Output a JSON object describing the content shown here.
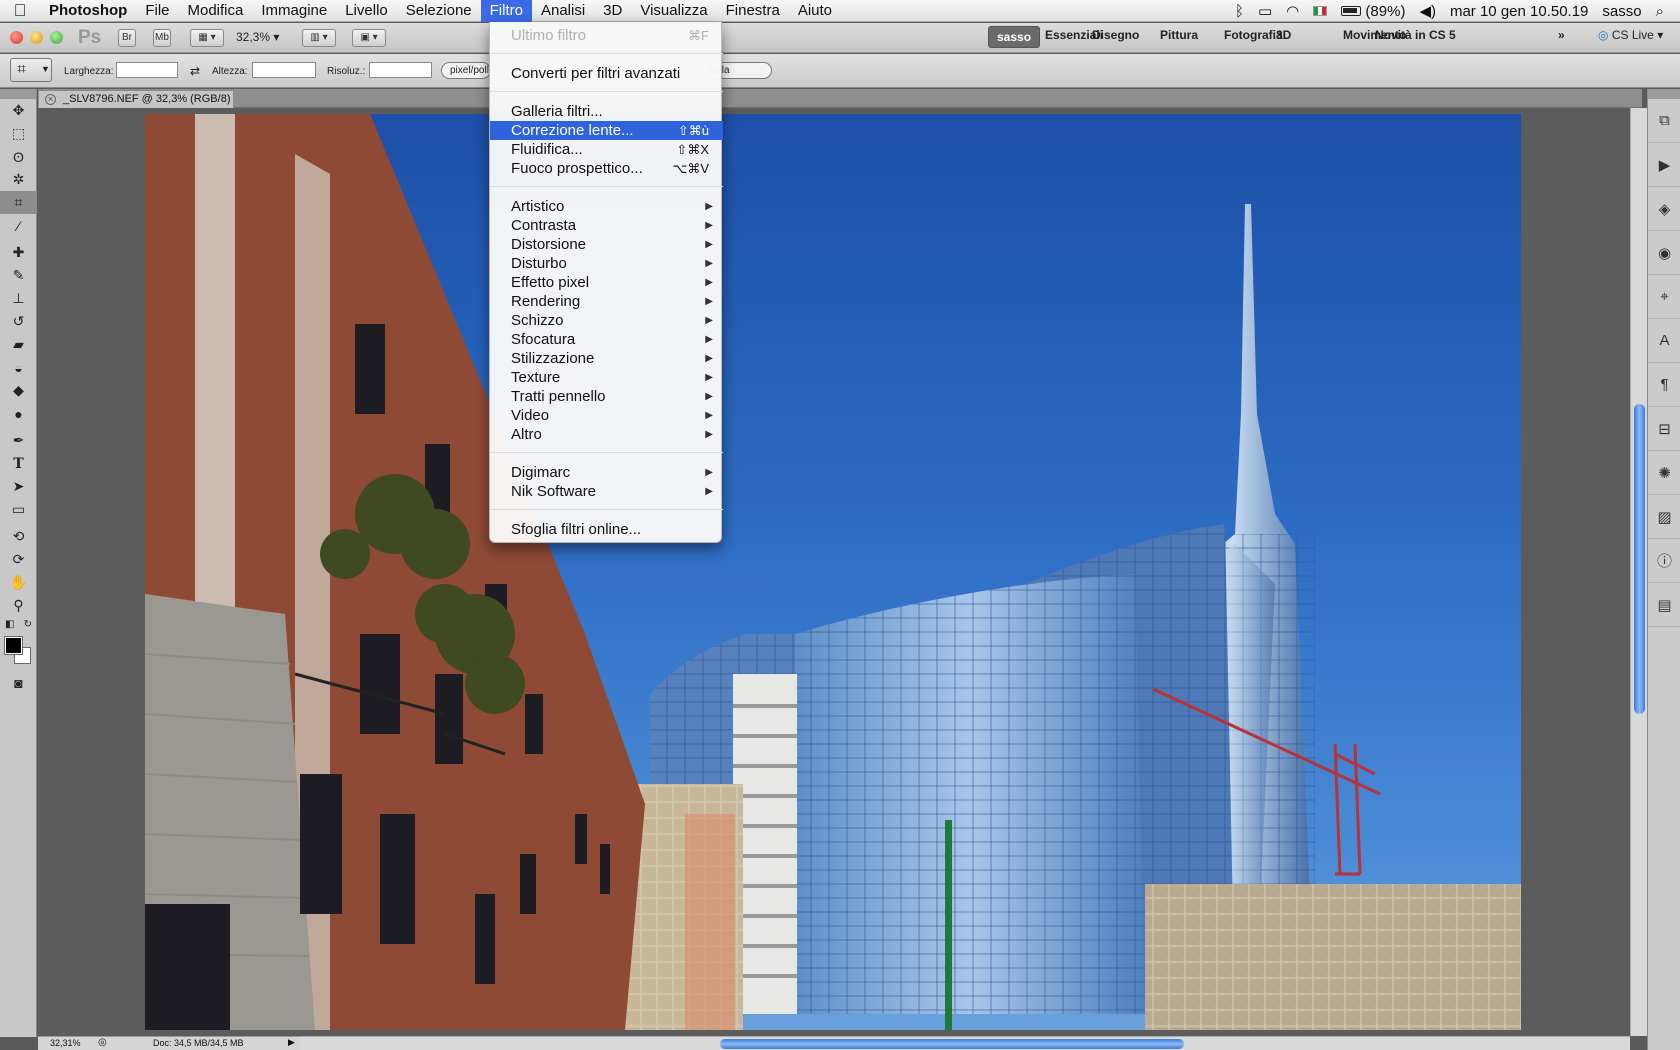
{
  "menubar": {
    "apple": "",
    "items": [
      "Photoshop",
      "File",
      "Modifica",
      "Immagine",
      "Livello",
      "Selezione",
      "Filtro",
      "Analisi",
      "3D",
      "Visualizza",
      "Finestra",
      "Aiuto"
    ],
    "active_index": 6,
    "status": {
      "battery": "(89%)",
      "datetime": "mar 10 gen  10.50.19",
      "user": "sasso"
    }
  },
  "appbar": {
    "ps": "Ps",
    "br": "Br",
    "mb": "Mb",
    "zoom": "32,3%",
    "workspaces": [
      "sasso",
      "Essenziali",
      "Disegno",
      "Pittura",
      "Fotografia",
      "3D",
      "Movimento",
      "Novità in CS 5"
    ],
    "overflow": "»",
    "cslive": "CS Live"
  },
  "options": {
    "width_label": "Larghezza:",
    "height_label": "Altezza:",
    "resolution_label": "Risoluz.:",
    "unit": "pixel/poll",
    "pill_tail": "cella"
  },
  "document": {
    "tab_title": "_SLV8796.NEF @ 32,3% (RGB/8)",
    "close": "×"
  },
  "status": {
    "zoom": "32,31%",
    "doc": "Doc: 34,5 MB/34,5 MB"
  },
  "filter_menu": {
    "groups": [
      [
        {
          "label": "Ultimo filtro",
          "shortcut": "⌘F",
          "disabled": true
        }
      ],
      [
        {
          "label": "Converti per filtri avanzati"
        }
      ],
      [
        {
          "label": "Galleria filtri..."
        },
        {
          "label": "Correzione lente...",
          "shortcut": "⇧⌘ù",
          "highlighted": true
        },
        {
          "label": "Fluidifica...",
          "shortcut": "⇧⌘X"
        },
        {
          "label": "Fuoco prospettico...",
          "shortcut": "⌥⌘V"
        }
      ],
      [
        {
          "label": "Artistico",
          "submenu": true
        },
        {
          "label": "Contrasta",
          "submenu": true
        },
        {
          "label": "Distorsione",
          "submenu": true
        },
        {
          "label": "Disturbo",
          "submenu": true
        },
        {
          "label": "Effetto pixel",
          "submenu": true
        },
        {
          "label": "Rendering",
          "submenu": true
        },
        {
          "label": "Schizzo",
          "submenu": true
        },
        {
          "label": "Sfocatura",
          "submenu": true
        },
        {
          "label": "Stilizzazione",
          "submenu": true
        },
        {
          "label": "Texture",
          "submenu": true
        },
        {
          "label": "Tratti pennello",
          "submenu": true
        },
        {
          "label": "Video",
          "submenu": true
        },
        {
          "label": "Altro",
          "submenu": true
        }
      ],
      [
        {
          "label": "Digimarc",
          "submenu": true
        },
        {
          "label": "Nik Software",
          "submenu": true
        }
      ],
      [
        {
          "label": "Sfoglia filtri online..."
        }
      ]
    ]
  },
  "colors": {
    "menu_highlight": "#2f63dc",
    "sky_top": "#1d4fa8",
    "sky_bottom": "#6aa1de",
    "scroll_thumb": "#3a7be0"
  }
}
